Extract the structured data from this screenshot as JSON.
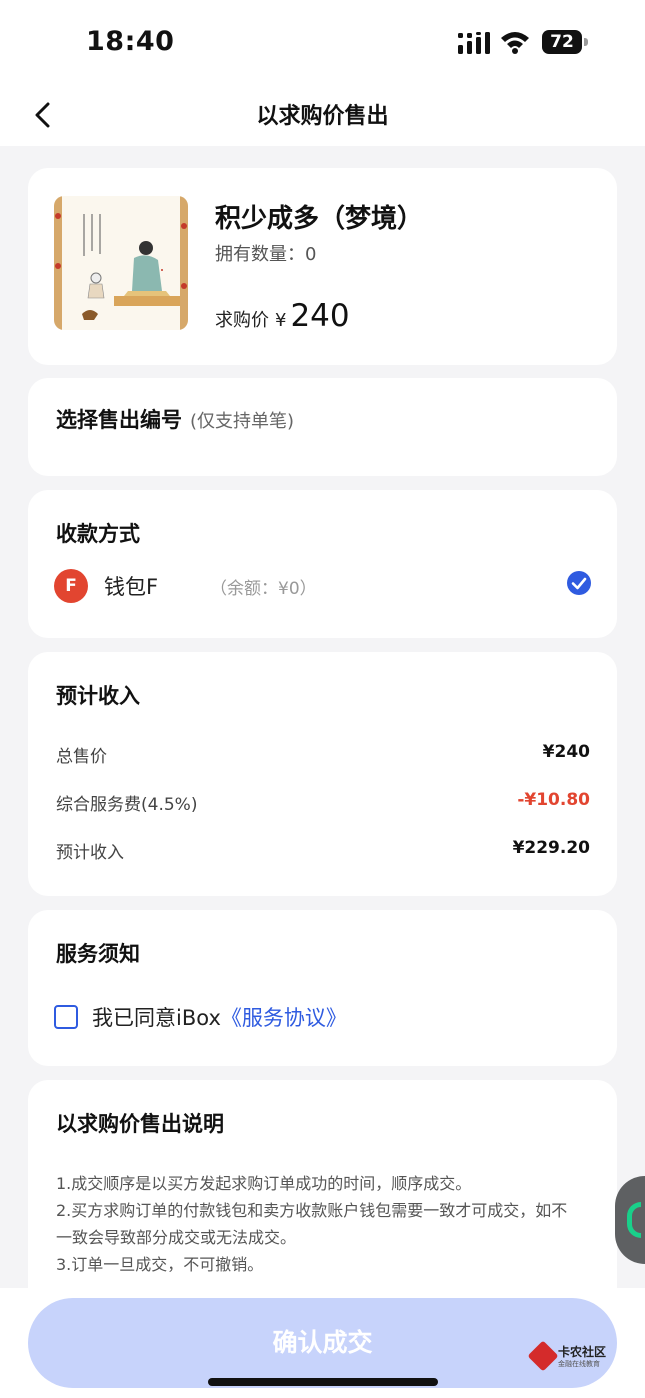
{
  "status_bar": {
    "time": "18:40",
    "battery": "72"
  },
  "nav": {
    "title": "以求购价售出"
  },
  "product": {
    "name": "积少成多（梦境）",
    "owned": "拥有数量：0",
    "price_label": "求购价",
    "currency": "¥",
    "price": "240"
  },
  "select": {
    "title": "选择售出编号",
    "note": "(仅支持单笔)"
  },
  "payment": {
    "title": "收款方式",
    "wallet_badge": "F",
    "wallet_name": "钱包F",
    "balance": "（余额：¥0）",
    "selected": true
  },
  "income": {
    "title": "预计收入",
    "rows": [
      {
        "label": "总售价",
        "value": "¥240"
      },
      {
        "label": "综合服务费(4.5%)",
        "value": "-¥10.80"
      },
      {
        "label": "预计收入",
        "value": "¥229.20"
      }
    ]
  },
  "notice": {
    "title": "服务须知",
    "agree_text": "我已同意iBox",
    "agree_link": "《服务协议》",
    "checked": false
  },
  "explain": {
    "title": "以求购价售出说明",
    "line1": "1.成交顺序是以买方发起求购订单成功的时间，顺序成交。",
    "line2": "2.买方求购订单的付款钱包和卖方收款账户钱包需要一致才可成交，如不一致会导致部分成交或无法成交。",
    "line3": "3.订单一旦成交，不可撤销。"
  },
  "confirm_button": "确认成交",
  "watermark": {
    "name": "卡农社区",
    "sub": "金融在线教育"
  },
  "colors": {
    "accent": "#2f5be0",
    "negative": "#e24530",
    "button_disabled": "#c7d3fb"
  }
}
